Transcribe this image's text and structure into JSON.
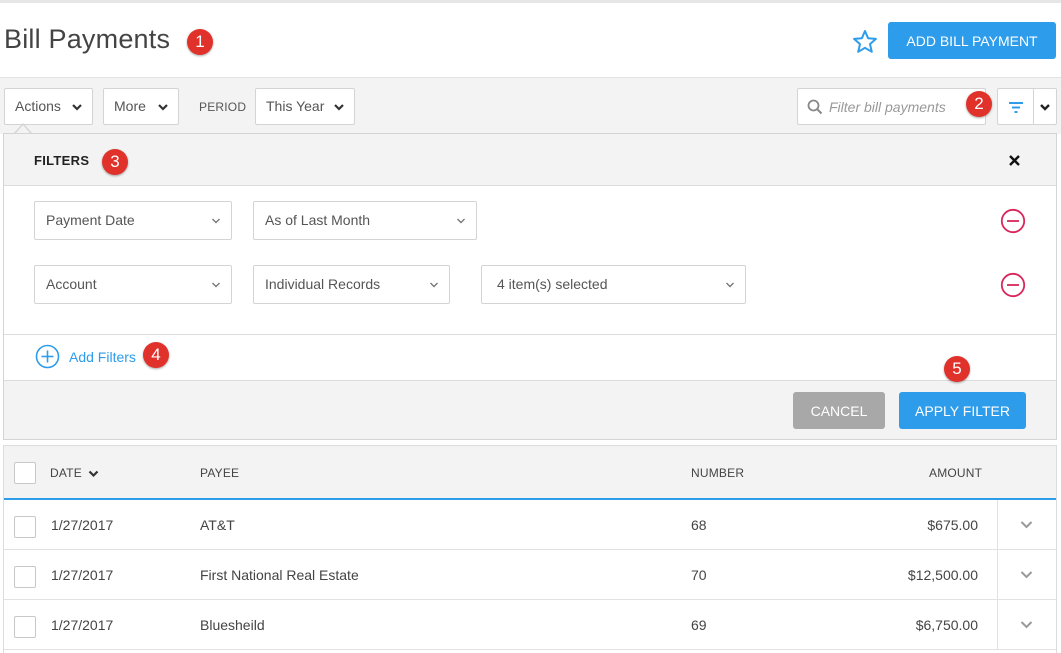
{
  "header": {
    "title": "Bill Payments",
    "star_icon": "star-outline-icon",
    "add_button_label": "ADD BILL PAYMENT"
  },
  "toolbar": {
    "actions_label": "Actions",
    "more_label": "More",
    "period_label": "PERIOD",
    "period_value": "This Year",
    "search_placeholder": "Filter bill payments",
    "filter_icon": "filter-icon"
  },
  "filters": {
    "title": "FILTERS",
    "rows": [
      {
        "field": "Payment Date",
        "operator": "As of Last Month"
      },
      {
        "field": "Account",
        "operator": "Individual Records",
        "value": "4 item(s) selected"
      }
    ],
    "add_label": "Add Filters",
    "cancel_label": "CANCEL",
    "apply_label": "APPLY FILTER"
  },
  "table": {
    "columns": [
      "DATE",
      "PAYEE",
      "NUMBER",
      "AMOUNT"
    ],
    "rows": [
      {
        "date": "1/27/2017",
        "payee": "AT&T",
        "number": "68",
        "amount": "$675.00"
      },
      {
        "date": "1/27/2017",
        "payee": "First National Real Estate",
        "number": "70",
        "amount": "$12,500.00"
      },
      {
        "date": "1/27/2017",
        "payee": "Bluesheild",
        "number": "69",
        "amount": "$6,750.00"
      }
    ]
  },
  "annotations": [
    "1",
    "2",
    "3",
    "4",
    "5"
  ],
  "colors": {
    "accent": "#2d9cea",
    "badge": "#e0322b",
    "remove": "#d9265a",
    "cancel": "#a8a8a8"
  }
}
